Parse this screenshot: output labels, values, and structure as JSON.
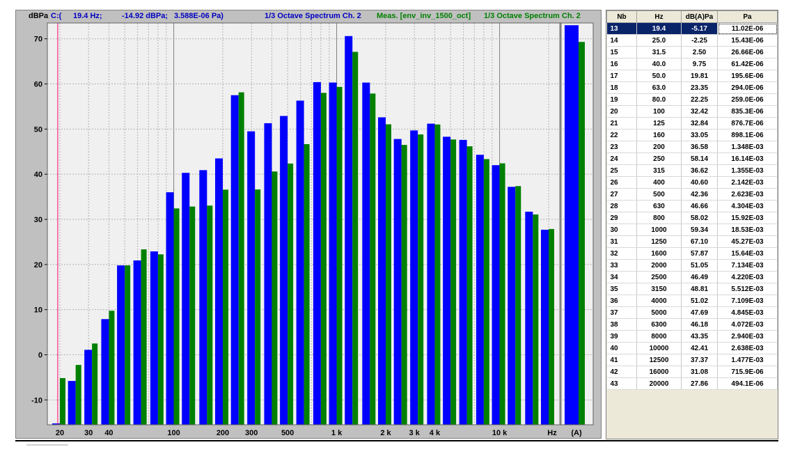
{
  "header": {
    "unit_label": "dBPa",
    "cursor_prefix": "C:(",
    "cursor_hz": "19.4 Hz;",
    "cursor_db": "-14.92 dBPa;",
    "cursor_pa": "3.588E-06  Pa)",
    "series1_title": "1/3 Octave Spectrum Ch. 2",
    "meas_label": "Meas. [env_inv_1500_oct]",
    "series2_title": "1/3 Octave Spectrum Ch. 2"
  },
  "colors": {
    "blue": "#0000ff",
    "green": "#008000",
    "cursor": "#ff0066",
    "plot_bg": "#f0f0f0",
    "header_blue": "#0000c0",
    "header_green": "#008000"
  },
  "chart_data": {
    "type": "bar",
    "x_scale": "log",
    "xlabel": "Hz",
    "ylabel": "dBPa",
    "ylim": [
      -15.5,
      73.5
    ],
    "y_ticks": [
      -10,
      0,
      10,
      20,
      30,
      40,
      50,
      60,
      70
    ],
    "x_tick_labels": [
      {
        "hz": 20,
        "label": "20"
      },
      {
        "hz": 30,
        "label": "30"
      },
      {
        "hz": 40,
        "label": "40"
      },
      {
        "hz": 100,
        "label": "100"
      },
      {
        "hz": 200,
        "label": "200"
      },
      {
        "hz": 300,
        "label": "300"
      },
      {
        "hz": 500,
        "label": "500"
      },
      {
        "hz": 1000,
        "label": "1 k"
      },
      {
        "hz": 2000,
        "label": "2 k"
      },
      {
        "hz": 3000,
        "label": "3 k"
      },
      {
        "hz": 4000,
        "label": "4 k"
      },
      {
        "hz": 10000,
        "label": "10 k"
      }
    ],
    "x_unit_label": "Hz",
    "overall_label": "(A)",
    "grid": true,
    "cursor_hz": 19.4,
    "bands": [
      20,
      25,
      31.5,
      40,
      50,
      63,
      80,
      100,
      125,
      160,
      200,
      250,
      315,
      400,
      500,
      630,
      800,
      1000,
      1250,
      1600,
      2000,
      2500,
      3150,
      4000,
      5000,
      6300,
      8000,
      10000,
      12500,
      16000,
      20000
    ],
    "series": [
      {
        "name": "1/3 Octave Spectrum Ch. 2",
        "color": "#0000ff",
        "values": [
          -15.2,
          -5.8,
          1.1,
          7.9,
          19.8,
          20.9,
          22.9,
          36.0,
          40.3,
          40.9,
          43.5,
          57.5,
          49.5,
          51.3,
          52.9,
          56.3,
          60.4,
          60.3,
          70.6,
          60.3,
          52.6,
          47.8,
          49.7,
          51.2,
          48.3,
          47.6,
          44.3,
          42.0,
          37.2,
          31.7,
          27.7
        ],
        "overall": 73.0
      },
      {
        "name": "Meas. [env_inv_1500_oct]",
        "color": "#008000",
        "values": [
          -5.17,
          -2.25,
          2.5,
          9.75,
          19.81,
          23.35,
          22.25,
          32.42,
          32.84,
          33.05,
          36.58,
          58.14,
          36.62,
          40.6,
          42.36,
          46.66,
          58.02,
          59.34,
          67.1,
          57.87,
          51.05,
          46.49,
          48.81,
          51.02,
          47.69,
          46.18,
          43.35,
          42.41,
          37.37,
          31.08,
          27.86
        ],
        "overall": 69.3
      }
    ]
  },
  "table": {
    "headers": {
      "nb": "Nb",
      "hz": "Hz",
      "db": "dB(A)Pa",
      "pa": "Pa"
    },
    "selected_index": 0,
    "rows": [
      {
        "nb": "13",
        "hz": "19.4",
        "db": "-5.17",
        "pa": "11.02E-06"
      },
      {
        "nb": "14",
        "hz": "25.0",
        "db": "-2.25",
        "pa": "15.43E-06"
      },
      {
        "nb": "15",
        "hz": "31.5",
        "db": "2.50",
        "pa": "26.66E-06"
      },
      {
        "nb": "16",
        "hz": "40.0",
        "db": "9.75",
        "pa": "61.42E-06"
      },
      {
        "nb": "17",
        "hz": "50.0",
        "db": "19.81",
        "pa": "195.6E-06"
      },
      {
        "nb": "18",
        "hz": "63.0",
        "db": "23.35",
        "pa": "294.0E-06"
      },
      {
        "nb": "19",
        "hz": "80.0",
        "db": "22.25",
        "pa": "259.0E-06"
      },
      {
        "nb": "20",
        "hz": "100",
        "db": "32.42",
        "pa": "835.3E-06"
      },
      {
        "nb": "21",
        "hz": "125",
        "db": "32.84",
        "pa": "876.7E-06"
      },
      {
        "nb": "22",
        "hz": "160",
        "db": "33.05",
        "pa": "898.1E-06"
      },
      {
        "nb": "23",
        "hz": "200",
        "db": "36.58",
        "pa": "1.348E-03"
      },
      {
        "nb": "24",
        "hz": "250",
        "db": "58.14",
        "pa": "16.14E-03"
      },
      {
        "nb": "25",
        "hz": "315",
        "db": "36.62",
        "pa": "1.355E-03"
      },
      {
        "nb": "26",
        "hz": "400",
        "db": "40.60",
        "pa": "2.142E-03"
      },
      {
        "nb": "27",
        "hz": "500",
        "db": "42.36",
        "pa": "2.623E-03"
      },
      {
        "nb": "28",
        "hz": "630",
        "db": "46.66",
        "pa": "4.304E-03"
      },
      {
        "nb": "29",
        "hz": "800",
        "db": "58.02",
        "pa": "15.92E-03"
      },
      {
        "nb": "30",
        "hz": "1000",
        "db": "59.34",
        "pa": "18.53E-03"
      },
      {
        "nb": "31",
        "hz": "1250",
        "db": "67.10",
        "pa": "45.27E-03"
      },
      {
        "nb": "32",
        "hz": "1600",
        "db": "57.87",
        "pa": "15.64E-03"
      },
      {
        "nb": "33",
        "hz": "2000",
        "db": "51.05",
        "pa": "7.134E-03"
      },
      {
        "nb": "34",
        "hz": "2500",
        "db": "46.49",
        "pa": "4.220E-03"
      },
      {
        "nb": "35",
        "hz": "3150",
        "db": "48.81",
        "pa": "5.512E-03"
      },
      {
        "nb": "36",
        "hz": "4000",
        "db": "51.02",
        "pa": "7.109E-03"
      },
      {
        "nb": "37",
        "hz": "5000",
        "db": "47.69",
        "pa": "4.845E-03"
      },
      {
        "nb": "38",
        "hz": "6300",
        "db": "46.18",
        "pa": "4.072E-03"
      },
      {
        "nb": "39",
        "hz": "8000",
        "db": "43.35",
        "pa": "2.940E-03"
      },
      {
        "nb": "40",
        "hz": "10000",
        "db": "42.41",
        "pa": "2.638E-03"
      },
      {
        "nb": "41",
        "hz": "12500",
        "db": "37.37",
        "pa": "1.477E-03"
      },
      {
        "nb": "42",
        "hz": "16000",
        "db": "31.08",
        "pa": "715.9E-06"
      },
      {
        "nb": "43",
        "hz": "20000",
        "db": "27.86",
        "pa": "494.1E-06"
      }
    ]
  }
}
